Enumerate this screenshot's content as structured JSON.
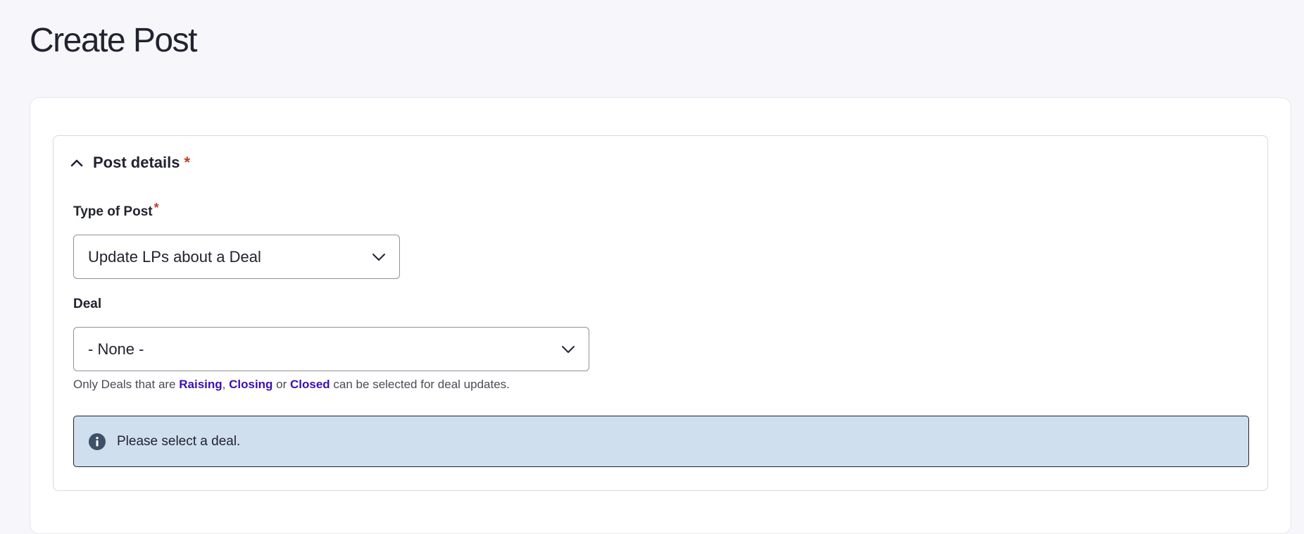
{
  "page": {
    "title": "Create Post"
  },
  "post_details": {
    "title": "Post details",
    "required_marker": "*",
    "expanded": true
  },
  "type_of_post": {
    "label": "Type of Post",
    "required_marker": "*",
    "selected": "Update LPs about a Deal"
  },
  "deal": {
    "label": "Deal",
    "selected": "- None -",
    "help": {
      "prefix": "Only Deals that are ",
      "link1": "Raising",
      "sep1": ", ",
      "link2": "Closing",
      "sep2": " or ",
      "link3": "Closed",
      "suffix": " can be selected for deal updates."
    }
  },
  "info_message": {
    "text": "Please select a deal.",
    "icon": "info-icon"
  },
  "colors": {
    "required": "#c83a26",
    "link": "#3b0fb5",
    "info_bg": "#d0dfee",
    "page_bg": "#f7f7fb"
  }
}
